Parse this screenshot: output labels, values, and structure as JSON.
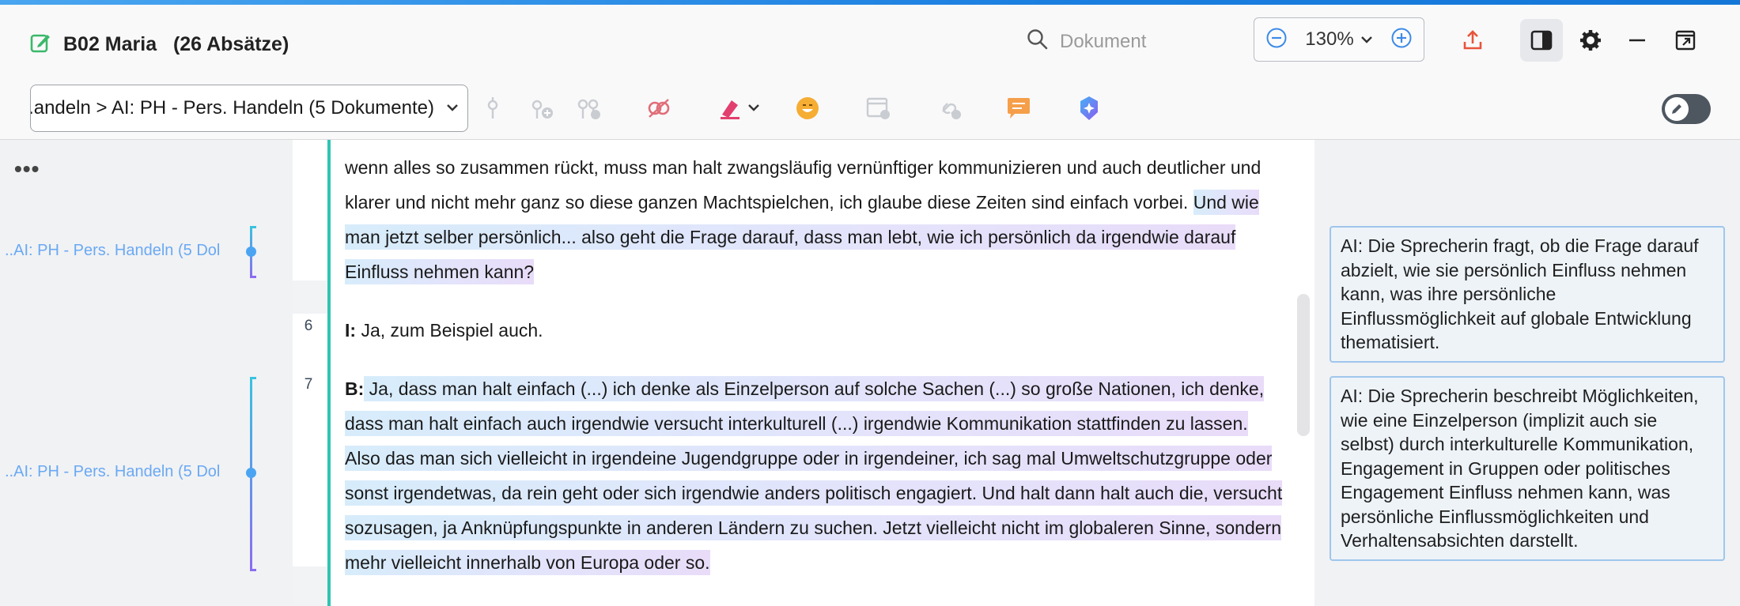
{
  "header": {
    "document_title": "B02 Maria   (26 Absätze)",
    "search_placeholder": "Dokument",
    "zoom_value": "130%",
    "colors": {
      "accent": "#1b7fe0",
      "export": "#e8543a",
      "code_bar": "#2fc4b2"
    }
  },
  "toolbar": {
    "code_select_value": "...andeln > AI: PH - Pers. Handeln (5 Dokumente)",
    "icons": [
      "code-icon",
      "code-add-icon",
      "code-settings-icon",
      "in-vivo-code-icon",
      "highlighter-icon",
      "emoticon-icon",
      "document-link-icon",
      "link-icon",
      "memo-icon",
      "ai-assist-icon"
    ]
  },
  "codes": [
    {
      "label": "AI: PH - Pers. Handeln (5 Dokumente)",
      "label_shown": "..AI: PH - Pers. Handeln (5 Dol"
    },
    {
      "label": "AI: PH - Pers. Handeln (5 Dokumente)",
      "label_shown": "..AI: PH - Pers. Handeln (5 Dol"
    }
  ],
  "paragraphs": [
    {
      "number": "",
      "plain": "wenn alles so zusammen rückt, muss man halt zwangsläufig vernünftiger kommunizieren und auch deutlicher und klarer und nicht mehr ganz so diese ganzen Machtspielchen, ich glaube diese Zeiten sind einfach vorbei. ",
      "coded": "Und wie man jetzt selber persönlich... also geht die Frage darauf, dass man lebt, wie ich persönlich da irgendwie darauf Einfluss nehmen kann?"
    },
    {
      "number": "6",
      "speaker": "I:",
      "text": " Ja, zum Beispiel auch."
    },
    {
      "number": "7",
      "speaker": "B:",
      "coded": " Ja, dass man halt einfach (...) ich denke als Einzelperson auf solche Sachen (...) so große Nationen, ich denke, dass man halt einfach auch irgendwie versucht interkulturell (...) irgendwie Kommunikation stattfinden zu lassen. Also das man sich vielleicht in irgendeine Jugendgruppe oder in irgendeiner, ich sag mal Umweltschutzgruppe oder sonst irgendetwas, da rein geht oder sich irgendwie anders politisch engagiert. Und halt dann halt auch die, versucht sozusagen, ja Anknüpfungspunkte in anderen Ländern zu suchen. Jetzt vielleicht nicht im globaleren Sinne, sondern mehr vielleicht innerhalb von Europa oder so."
    }
  ],
  "memos": [
    "AI: Die Sprecherin fragt, ob die Frage darauf abzielt, wie sie persönlich Einfluss nehmen kann, was ihre persönliche Einflussmöglichkeit auf globale Entwicklung thematisiert.",
    "AI: Die Sprecherin beschreibt Möglichkeiten, wie eine Einzelperson (implizit auch sie selbst) durch interkulturelle Kommunikation, Engagement in Gruppen oder politisches Engagement Einfluss nehmen kann, was persönliche Einflussmöglichkeiten und Verhaltensabsichten darstellt."
  ]
}
